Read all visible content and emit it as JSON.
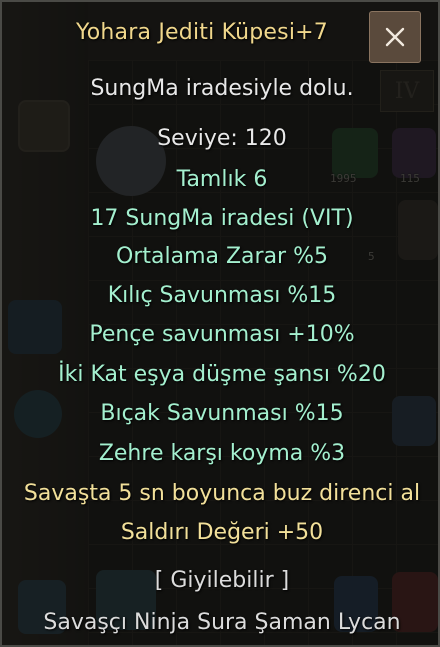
{
  "tooltip": {
    "title": "Yohara Jediti Küpesi+7",
    "description": "SungMa iradesiyle dolu.",
    "level": "Seviye: 120",
    "perfection": "Tamlık 6",
    "attributes": [
      "17 SungMa iradesi (VIT)",
      "Ortalama Zarar %5",
      "Kılıç Savunması %15",
      "Pençe savunması +10%",
      "İki Kat eşya düşme şansı %20",
      "Bıçak Savunması %15",
      "Zehre karşı koyma %3"
    ],
    "special": [
      "Savaşta 5 sn boyunca buz direnci al",
      "Saldırı Değeri +50"
    ],
    "wearable": "[ Giyilebilir ]",
    "classes": "Savaşçı Ninja Sura Şaman Lycan"
  },
  "close_icon": "close-x-icon",
  "background": {
    "tab_label": "IV",
    "counts": [
      "1995",
      "115"
    ],
    "slot_badge": "5"
  },
  "colors": {
    "title": "#f0d78c",
    "description": "#e8e8e8",
    "attribute": "#a4f0cf",
    "special": "#f2e09a",
    "close_button": "#5a4a3c"
  }
}
